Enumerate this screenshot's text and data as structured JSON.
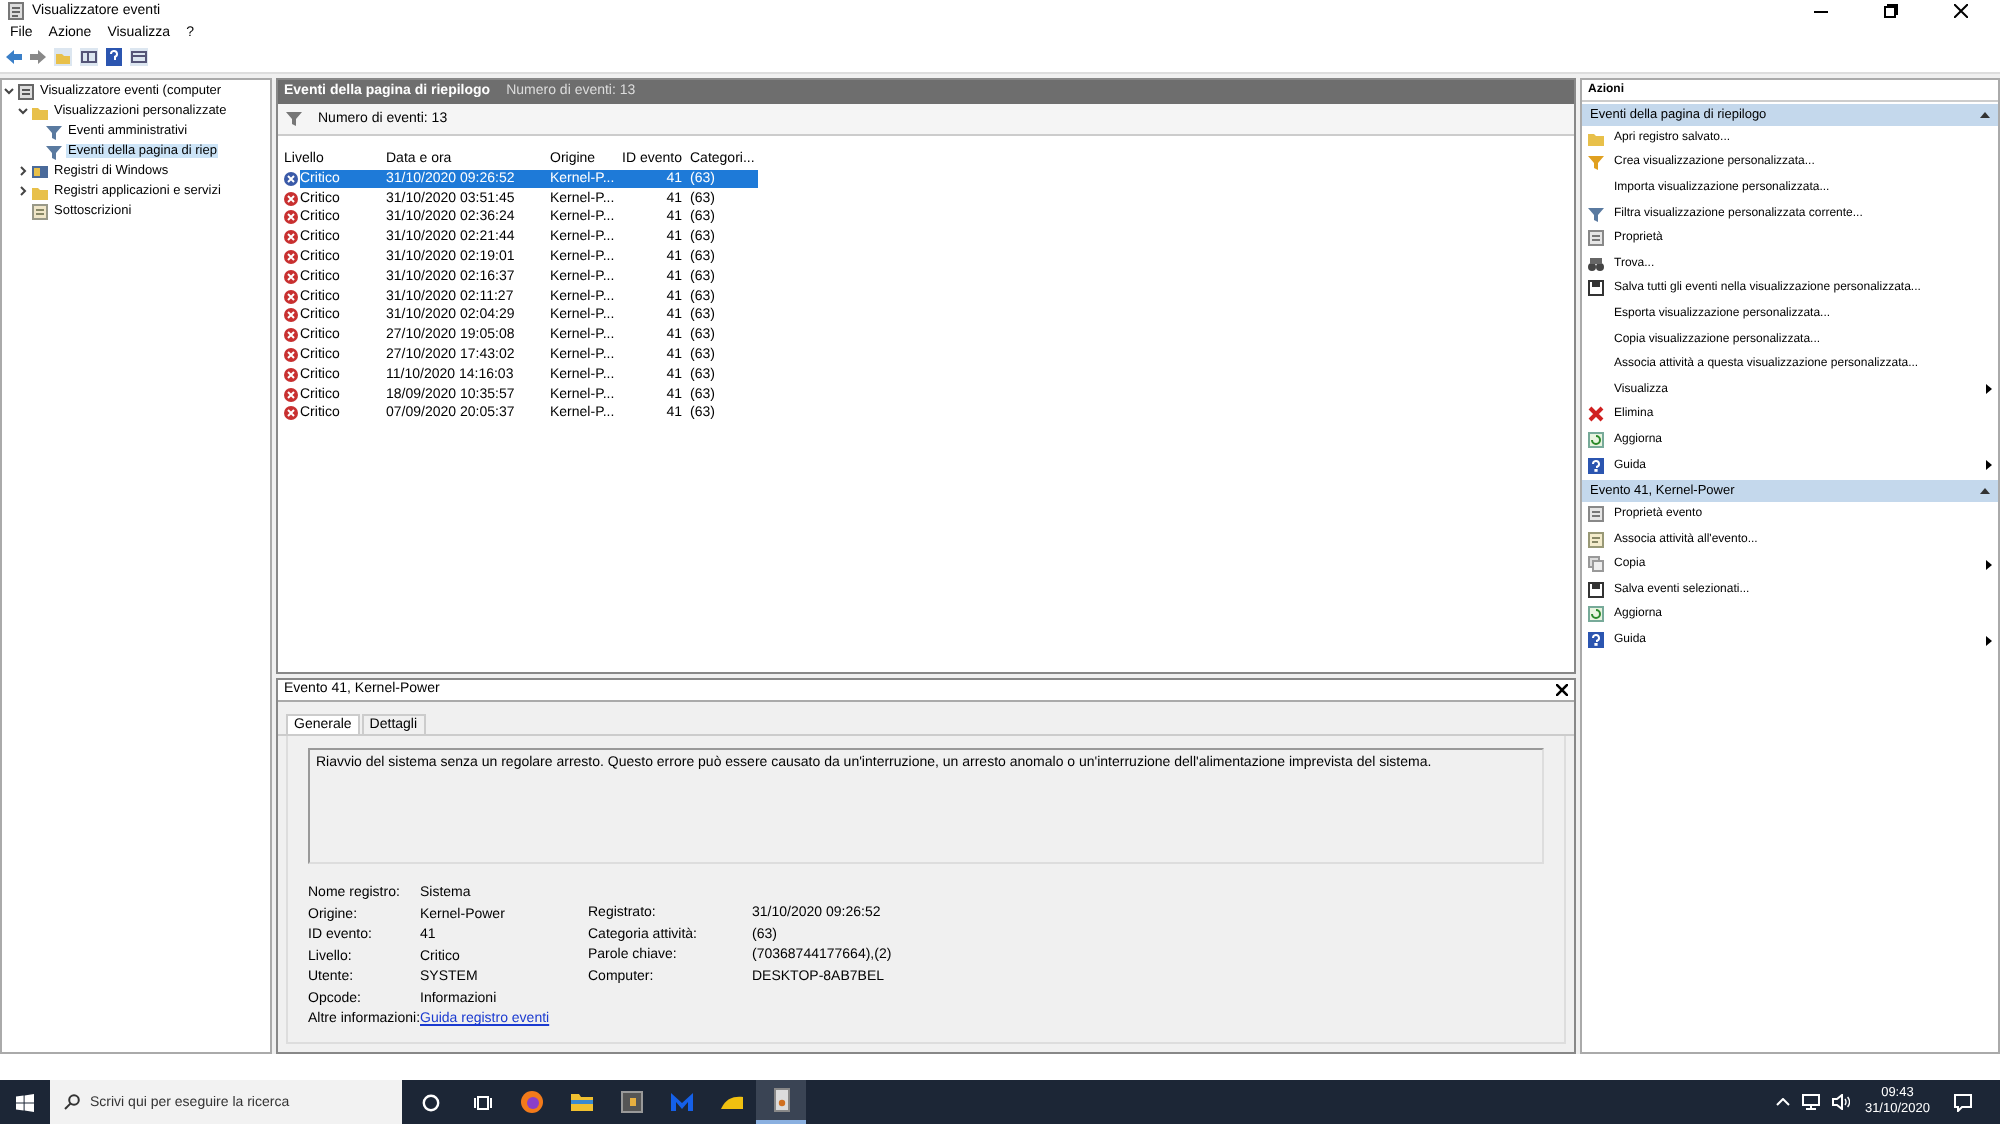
{
  "window": {
    "title": "Visualizzatore eventi"
  },
  "menu": [
    "File",
    "Azione",
    "Visualizza",
    "?"
  ],
  "tree": [
    {
      "label": "Visualizzatore eventi (computer",
      "kind": "root",
      "expanded": true,
      "selected": false,
      "children": [
        {
          "label": "Visualizzazioni personalizzate",
          "kind": "folder",
          "expanded": true,
          "selected": false,
          "children": [
            {
              "label": "Eventi amministrativi",
              "kind": "filter",
              "selected": false
            },
            {
              "label": "Eventi della pagina di riep",
              "kind": "filter",
              "selected": true
            }
          ]
        },
        {
          "label": "Registri di Windows",
          "kind": "logs",
          "expanded": false,
          "selected": false
        },
        {
          "label": "Registri applicazioni e servizi",
          "kind": "folder",
          "expanded": false,
          "selected": false
        },
        {
          "label": "Sottoscrizioni",
          "kind": "subs",
          "selected": false
        }
      ]
    }
  ],
  "events_pane": {
    "title": "Eventi della pagina di riepilogo",
    "subtitle": "Numero di eventi: 13",
    "filter_text": "Numero di eventi: 13",
    "columns": [
      "Livello",
      "Data e ora",
      "Origine",
      "ID evento",
      "Categori..."
    ],
    "rows": [
      {
        "level": "Critico",
        "date": "31/10/2020 09:26:52",
        "source": "Kernel-P...",
        "id": "41",
        "category": "(63)",
        "selected": true
      },
      {
        "level": "Critico",
        "date": "31/10/2020 03:51:45",
        "source": "Kernel-P...",
        "id": "41",
        "category": "(63)",
        "selected": false
      },
      {
        "level": "Critico",
        "date": "31/10/2020 02:36:24",
        "source": "Kernel-P...",
        "id": "41",
        "category": "(63)",
        "selected": false
      },
      {
        "level": "Critico",
        "date": "31/10/2020 02:21:44",
        "source": "Kernel-P...",
        "id": "41",
        "category": "(63)",
        "selected": false
      },
      {
        "level": "Critico",
        "date": "31/10/2020 02:19:01",
        "source": "Kernel-P...",
        "id": "41",
        "category": "(63)",
        "selected": false
      },
      {
        "level": "Critico",
        "date": "31/10/2020 02:16:37",
        "source": "Kernel-P...",
        "id": "41",
        "category": "(63)",
        "selected": false
      },
      {
        "level": "Critico",
        "date": "31/10/2020 02:11:27",
        "source": "Kernel-P...",
        "id": "41",
        "category": "(63)",
        "selected": false
      },
      {
        "level": "Critico",
        "date": "31/10/2020 02:04:29",
        "source": "Kernel-P...",
        "id": "41",
        "category": "(63)",
        "selected": false
      },
      {
        "level": "Critico",
        "date": "27/10/2020 19:05:08",
        "source": "Kernel-P...",
        "id": "41",
        "category": "(63)",
        "selected": false
      },
      {
        "level": "Critico",
        "date": "27/10/2020 17:43:02",
        "source": "Kernel-P...",
        "id": "41",
        "category": "(63)",
        "selected": false
      },
      {
        "level": "Critico",
        "date": "11/10/2020 14:16:03",
        "source": "Kernel-P...",
        "id": "41",
        "category": "(63)",
        "selected": false
      },
      {
        "level": "Critico",
        "date": "18/09/2020 10:35:57",
        "source": "Kernel-P...",
        "id": "41",
        "category": "(63)",
        "selected": false
      },
      {
        "level": "Critico",
        "date": "07/09/2020 20:05:37",
        "source": "Kernel-P...",
        "id": "41",
        "category": "(63)",
        "selected": false
      }
    ]
  },
  "detail": {
    "title": "Evento 41, Kernel-Power",
    "tabs": [
      {
        "label": "Generale",
        "selected": true
      },
      {
        "label": "Dettagli",
        "selected": false
      }
    ],
    "description": "Riavvio del sistema senza un regolare arresto. Questo errore può essere causato da un'interruzione, un arresto anomalo o un'interruzione dell'alimentazione imprevista del sistema.",
    "fields_left": [
      {
        "label": "Nome registro:",
        "value": "Sistema"
      },
      {
        "label": "Origine:",
        "value": "Kernel-Power"
      },
      {
        "label": "ID evento:",
        "value": "41"
      },
      {
        "label": "Livello:",
        "value": "Critico"
      },
      {
        "label": "Utente:",
        "value": "SYSTEM"
      },
      {
        "label": "Opcode:",
        "value": "Informazioni"
      }
    ],
    "fields_right": [
      {
        "label": "Registrato:",
        "value": "31/10/2020 09:26:52"
      },
      {
        "label": "Categoria attività:",
        "value": "(63)"
      },
      {
        "label": "Parole chiave:",
        "value": "(70368744177664),(2)"
      },
      {
        "label": "Computer:",
        "value": "DESKTOP-8AB7BEL"
      }
    ],
    "more_info": {
      "label": "Altre informazioni:",
      "link": "Guida registro eventi"
    }
  },
  "actions": {
    "title": "Azioni",
    "sections": [
      {
        "title": "Eventi della pagina di riepilogo",
        "expanded": true,
        "items": [
          {
            "label": "Apri registro salvato...",
            "kind": "folder",
            "submenu": false
          },
          {
            "label": "Crea visualizzazione personalizzata...",
            "kind": "filter-color",
            "submenu": false
          },
          {
            "label": "Importa visualizzazione personalizzata...",
            "kind": "none",
            "submenu": false
          },
          {
            "label": "Filtra visualizzazione personalizzata corrente...",
            "kind": "filter",
            "submenu": false
          },
          {
            "label": "Proprietà",
            "kind": "properties",
            "submenu": false
          },
          {
            "label": "Trova...",
            "kind": "find",
            "submenu": false
          },
          {
            "label": "Salva tutti gli eventi nella visualizzazione personalizzata...",
            "kind": "save",
            "submenu": false
          },
          {
            "label": "Esporta visualizzazione personalizzata...",
            "kind": "none",
            "submenu": false
          },
          {
            "label": "Copia visualizzazione personalizzata...",
            "kind": "none",
            "submenu": false
          },
          {
            "label": "Associa attività a questa visualizzazione personalizzata...",
            "kind": "none",
            "submenu": false
          },
          {
            "label": "Visualizza",
            "kind": "none",
            "submenu": true
          },
          {
            "label": "Elimina",
            "kind": "delete",
            "submenu": false
          },
          {
            "label": "Aggiorna",
            "kind": "refresh",
            "submenu": false
          },
          {
            "label": "Guida",
            "kind": "help",
            "submenu": true
          }
        ]
      },
      {
        "title": "Evento 41, Kernel-Power",
        "expanded": true,
        "items": [
          {
            "label": "Proprietà evento",
            "kind": "properties",
            "submenu": false
          },
          {
            "label": "Associa attività all'evento...",
            "kind": "task",
            "submenu": false
          },
          {
            "label": "Copia",
            "kind": "copy",
            "submenu": true
          },
          {
            "label": "Salva eventi selezionati...",
            "kind": "save",
            "submenu": false
          },
          {
            "label": "Aggiorna",
            "kind": "refresh",
            "submenu": false
          },
          {
            "label": "Guida",
            "kind": "help",
            "submenu": true
          }
        ]
      }
    ]
  },
  "taskbar": {
    "search_placeholder": "Scrivi qui per eseguire la ricerca",
    "apps": [
      {
        "kind": "firefox",
        "active": false
      },
      {
        "kind": "explorer",
        "active": false
      },
      {
        "kind": "dark",
        "active": false
      },
      {
        "kind": "m",
        "active": false
      },
      {
        "kind": "yellow",
        "active": false
      },
      {
        "kind": "viewer",
        "active": true
      }
    ],
    "time": "09:43",
    "date": "31/10/2020"
  }
}
